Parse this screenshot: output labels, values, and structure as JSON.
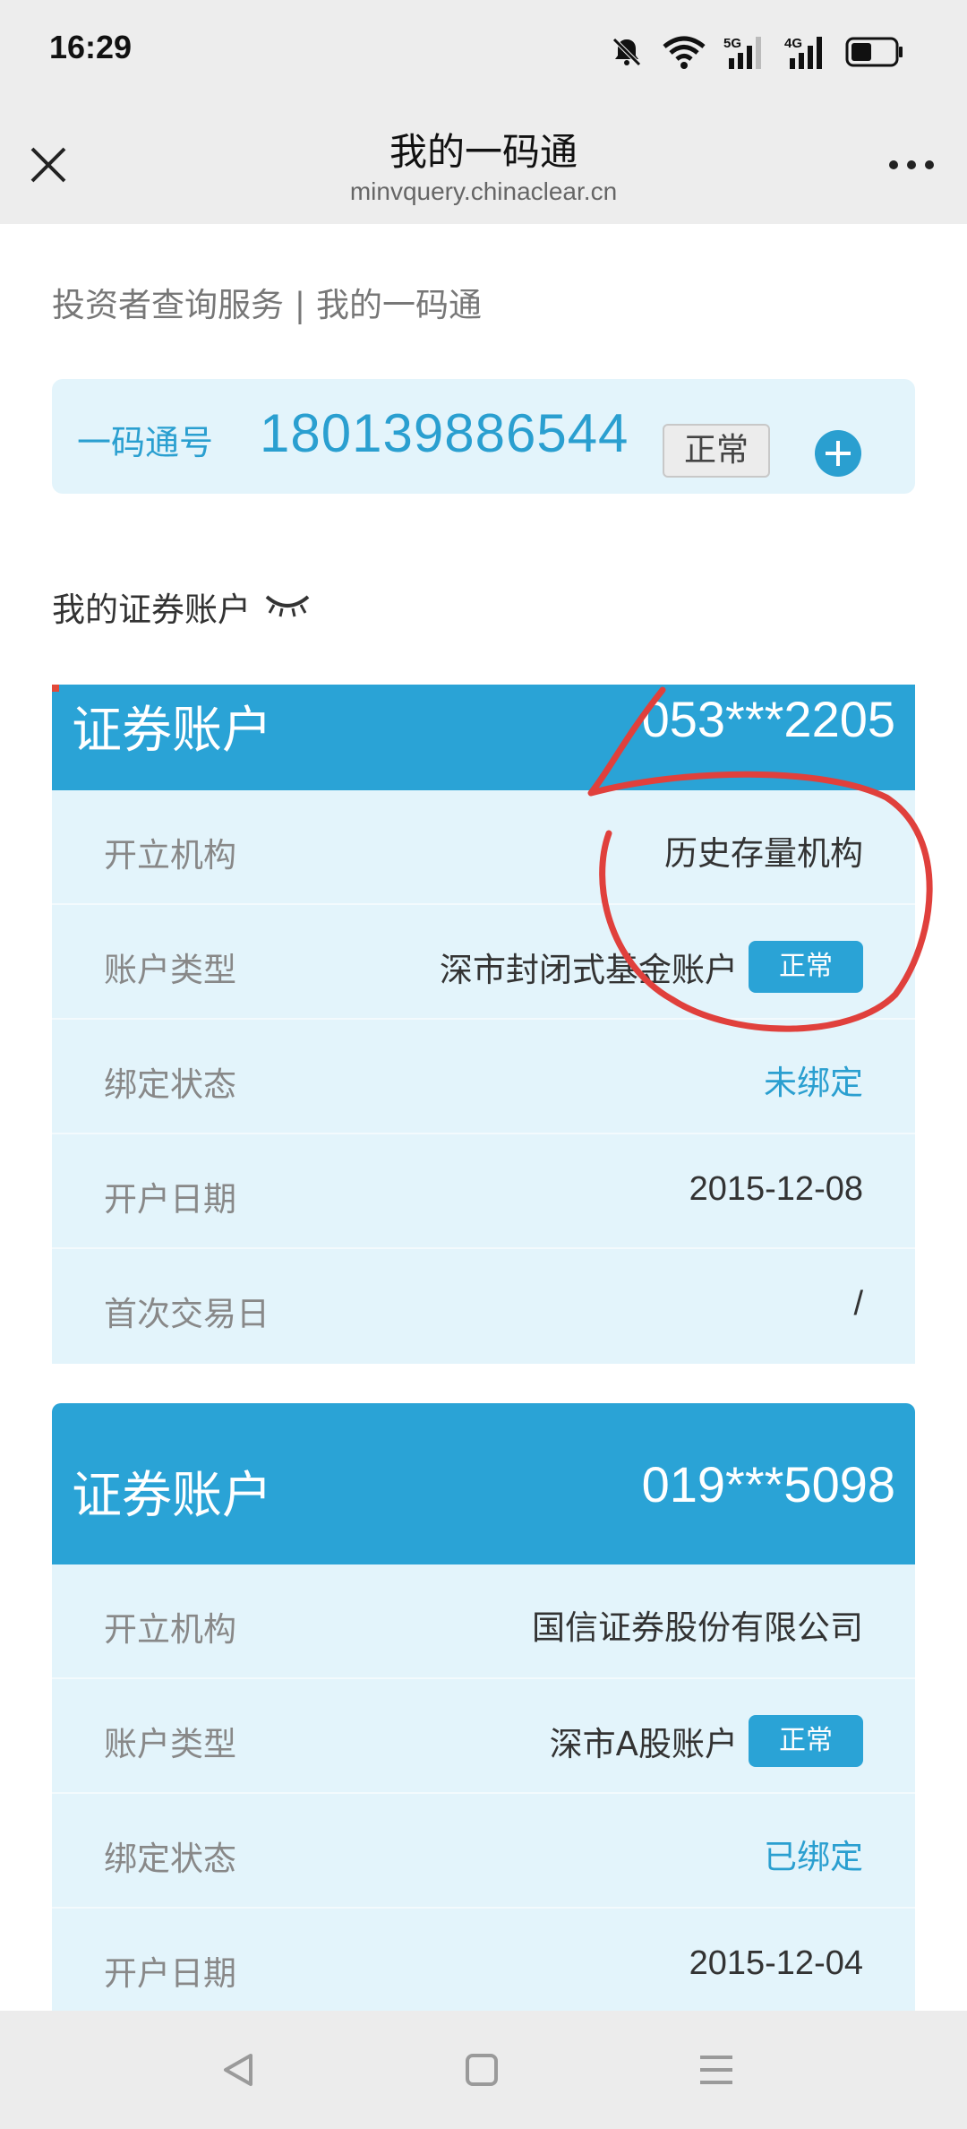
{
  "status_bar": {
    "time": "16:29",
    "icons": [
      "bell-off-icon",
      "wifi-icon",
      "signal-5g-icon",
      "signal-4g-icon",
      "battery-icon"
    ],
    "labels": {
      "net1": "5G",
      "net2": "4G"
    }
  },
  "nav": {
    "title": "我的一码通",
    "url": "minvquery.chinaclear.cn",
    "close_icon": "close-icon",
    "more_icon": "more-icon"
  },
  "breadcrumb": "投资者查询服务 | 我的一码通",
  "code_card": {
    "label": "一码通号",
    "number": "180139886544",
    "status": "正常",
    "add_icon": "plus-circle-icon"
  },
  "section_title": "我的证券账户",
  "accounts": [
    {
      "title": "证券账户",
      "number": "053***2205",
      "rows": [
        {
          "label": "开立机构",
          "value": "历史存量机构"
        },
        {
          "label": "账户类型",
          "value": "深市封闭式基金账户",
          "badge": "正常"
        },
        {
          "label": "绑定状态",
          "value": "未绑定"
        },
        {
          "label": "开户日期",
          "value": "2015-12-08"
        },
        {
          "label": "首次交易日",
          "value": "/"
        }
      ]
    },
    {
      "title": "证券账户",
      "number": "019***5098",
      "rows": [
        {
          "label": "开立机构",
          "value": "国信证券股份有限公司"
        },
        {
          "label": "账户类型",
          "value": "深市A股账户",
          "badge": "正常"
        },
        {
          "label": "绑定状态",
          "value": "已绑定"
        },
        {
          "label": "开户日期",
          "value": "2015-12-04"
        }
      ]
    }
  ],
  "colors": {
    "accent": "#2aa3d6",
    "card_bg": "#e3f4fb",
    "annotation": "#e0403c"
  },
  "system_nav": [
    "back-icon",
    "home-icon",
    "menu-icon"
  ]
}
